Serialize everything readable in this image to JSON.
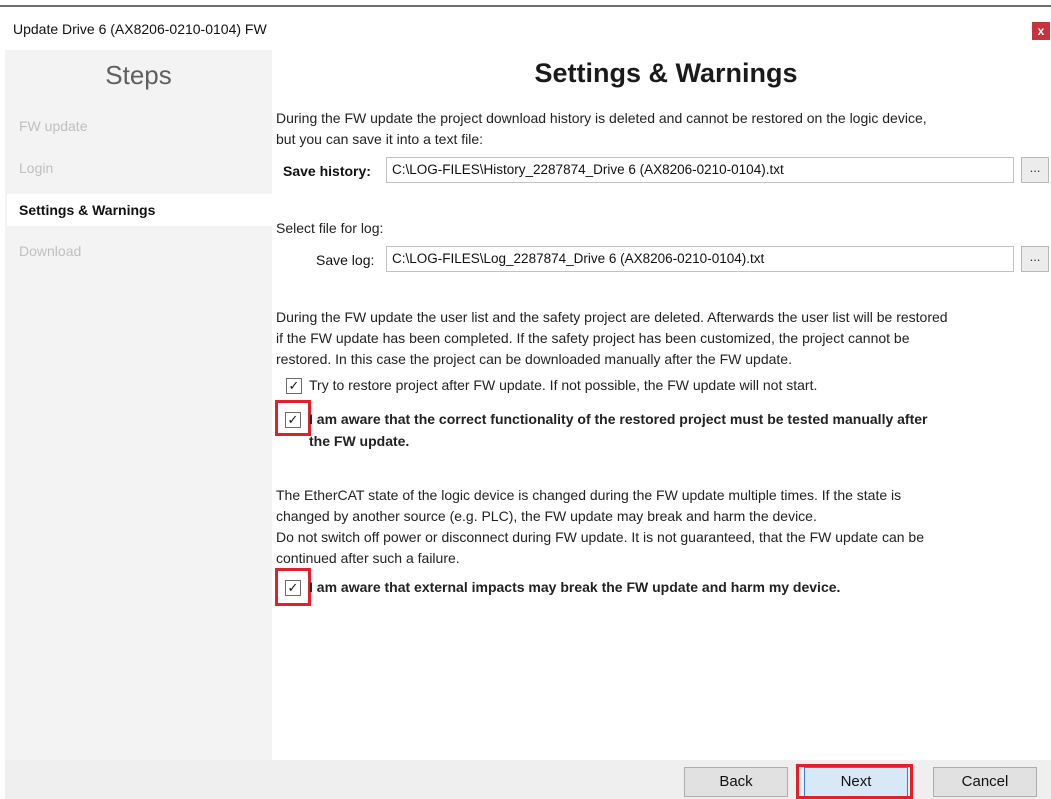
{
  "window": {
    "title": "Update Drive 6 (AX8206-0210-0104) FW",
    "close_label": "x"
  },
  "sidebar": {
    "heading": "Steps",
    "steps": [
      {
        "label": "FW update"
      },
      {
        "label": "Login"
      },
      {
        "label": "Settings & Warnings"
      },
      {
        "label": "Download"
      }
    ]
  },
  "main": {
    "heading": "Settings & Warnings",
    "history_info_line1": "During the FW update the project download history is deleted and cannot be restored on the logic device,",
    "history_info_line2": "but you can save it into a text file:",
    "save_history_label": "Save history:",
    "save_history_value": "C:\\LOG-FILES\\History_2287874_Drive 6 (AX8206-0210-0104).txt",
    "browse_label": "...",
    "select_log_label": "Select file for log:",
    "save_log_label": "Save log:",
    "save_log_value": "C:\\LOG-FILES\\Log_2287874_Drive 6 (AX8206-0210-0104).txt",
    "user_list_info_line1": "During the FW update the user list and the safety project are deleted. Afterwards the user list will be restored",
    "user_list_info_line2": "if the FW update has been completed. If the safety project has been customized, the project cannot be",
    "user_list_info_line3": "restored. In this case the project can be downloaded manually after the FW update.",
    "restore_checkbox_label": "Try to restore project after FW update. If not possible, the FW update will not start.",
    "aware_tested_line1": "I am aware that the correct functionality of the restored project must be tested manually after",
    "aware_tested_line2": "the FW update.",
    "ethercat_info_line1": "The EtherCAT state of the logic device is changed during the FW update multiple times. If the state is",
    "ethercat_info_line2": "changed by another source (e.g. PLC), the FW update may break and harm the device.",
    "ethercat_info_line3": "Do not switch off power or disconnect during FW update. It is not guaranteed, that the FW update can be",
    "ethercat_info_line4": "continued after such a failure.",
    "aware_external_label": "I am aware that external impacts may break the FW update and harm my device.",
    "checkmark": "✓"
  },
  "checkboxes": {
    "restore_project": true,
    "aware_tested": true,
    "aware_external": true
  },
  "footer": {
    "back_label": "Back",
    "next_label": "Next",
    "cancel_label": "Cancel"
  },
  "colors": {
    "highlight": "#e0202a",
    "close_button": "#c8323c"
  }
}
